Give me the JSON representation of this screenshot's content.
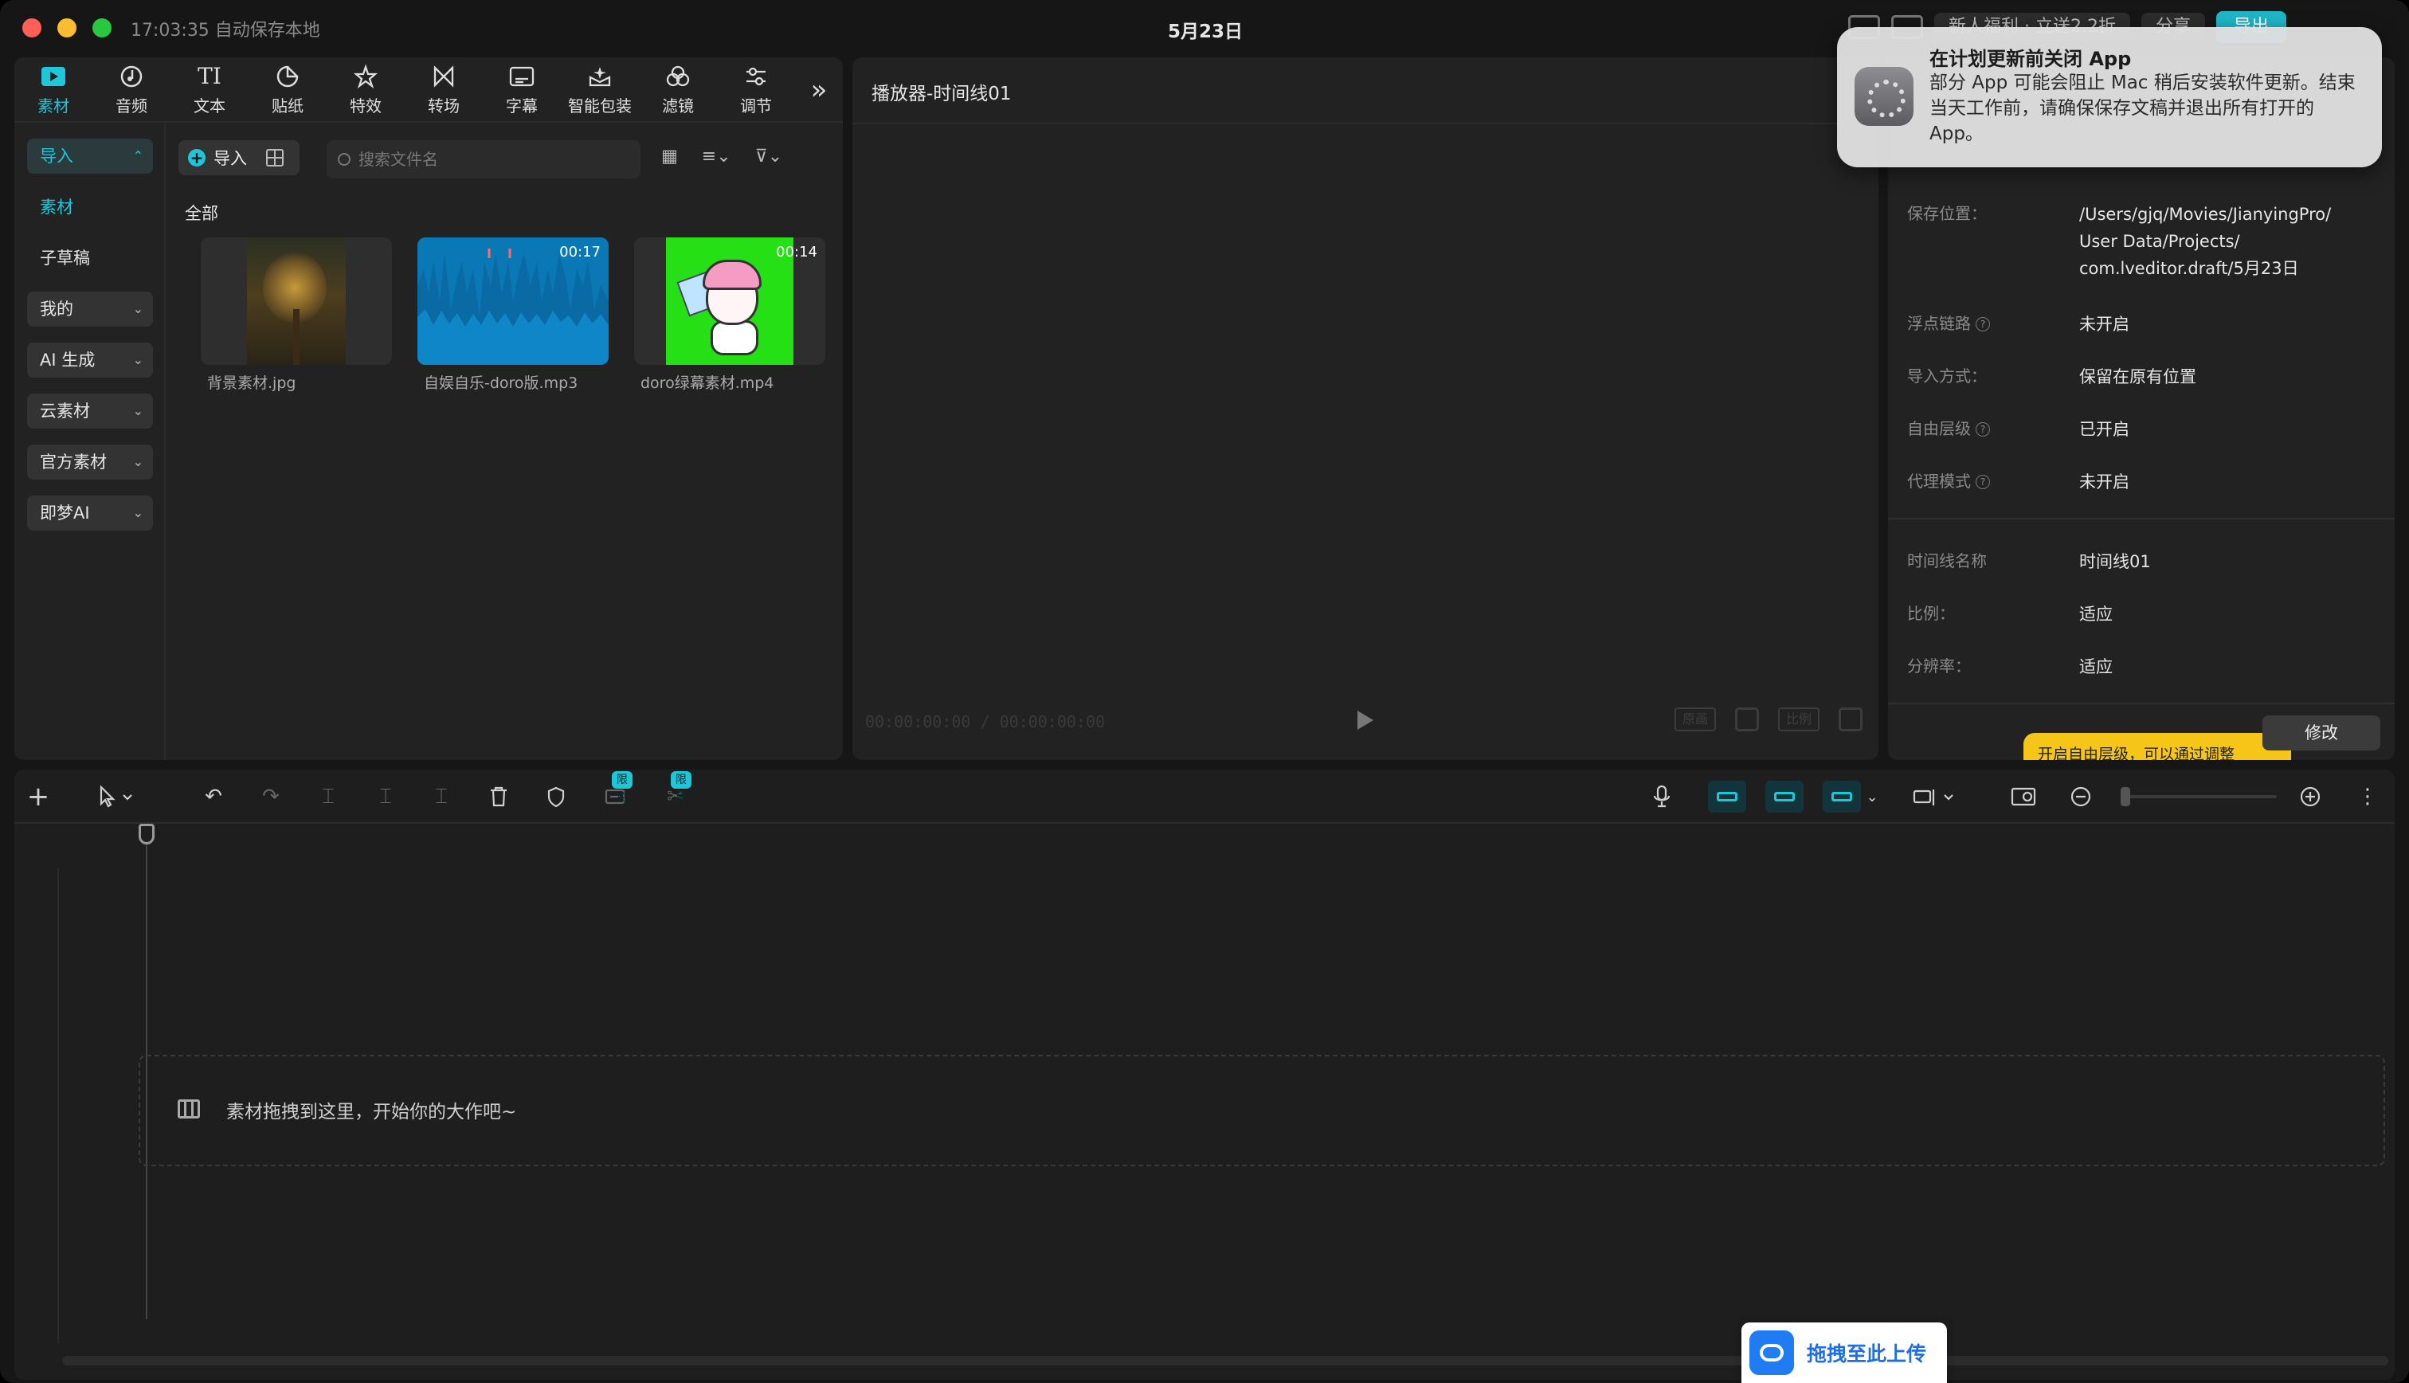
{
  "titlebar": {
    "autosave": "17:03:35 自动保存本地",
    "doc_title": "5月23日",
    "pill1": "新人福利 · 立送2.2折",
    "pill2": "分享",
    "export": "导出"
  },
  "media_tabs": [
    {
      "label": "素材",
      "icon": "media-icon"
    },
    {
      "label": "音频",
      "icon": "audio-icon"
    },
    {
      "label": "文本",
      "icon": "text-icon"
    },
    {
      "label": "贴纸",
      "icon": "sticker-icon"
    },
    {
      "label": "特效",
      "icon": "effects-icon"
    },
    {
      "label": "转场",
      "icon": "transition-icon"
    },
    {
      "label": "字幕",
      "icon": "caption-icon"
    },
    {
      "label": "智能包装",
      "icon": "smart-pack-icon"
    },
    {
      "label": "滤镜",
      "icon": "filter-icon"
    },
    {
      "label": "调节",
      "icon": "adjust-icon"
    }
  ],
  "sidebar": {
    "import": "导入",
    "media": "素材",
    "sub_draft": "子草稿",
    "mine": "我的",
    "ai_gen": "AI 生成",
    "cloud": "云素材",
    "official": "官方素材",
    "jimeng": "即梦AI"
  },
  "media": {
    "import_label": "导入",
    "search_placeholder": "搜索文件名",
    "section_all": "全部",
    "items": [
      {
        "name": "背景素材.jpg",
        "duration": ""
      },
      {
        "name": "自娱自乐-doro版.mp3",
        "duration": "00:17"
      },
      {
        "name": "doro绿幕素材.mp4",
        "duration": "00:14"
      }
    ]
  },
  "player": {
    "title": "播放器-时间线01",
    "timecode": "00:00:00:00 / 00:00:00:00",
    "btn_original": "原画",
    "btn_ratio": "比例"
  },
  "props": {
    "rows": [
      {
        "key": "保存位置：",
        "value": "/Users/gjq/Movies/JianyingPro/\nUser Data/Projects/\ncom.lveditor.draft/5月23日",
        "help": false
      },
      {
        "key": "浮点链路",
        "value": "未开启",
        "help": true
      },
      {
        "key": "导入方式：",
        "value": "保留在原有位置",
        "help": false
      },
      {
        "key": "自由层级",
        "value": "已开启",
        "help": true
      },
      {
        "key": "代理模式",
        "value": "未开启",
        "help": true
      }
    ],
    "timeline_rows": [
      {
        "key": "时间线名称",
        "value": "时间线01"
      },
      {
        "key": "比例：",
        "value": "适应"
      },
      {
        "key": "分辨率：",
        "value": "适应"
      }
    ],
    "modify": "修改",
    "tip": "开启自由层级，可以通过调整"
  },
  "notification": {
    "title": "在计划更新前关闭 App",
    "body": "部分 App 可能会阻止 Mac 稍后安装软件更新。结束当天工作前，请确保保存文稿并退出所有打开的 App。"
  },
  "timeline": {
    "badge1": "限免",
    "badge2": "限免",
    "drop_hint": "素材拖拽到这里，开始你的大作吧~"
  },
  "upload": {
    "label": "拖拽至此上传"
  },
  "colors": {
    "accent": "#1fc6d8",
    "panel": "#222222",
    "background": "#161616"
  }
}
